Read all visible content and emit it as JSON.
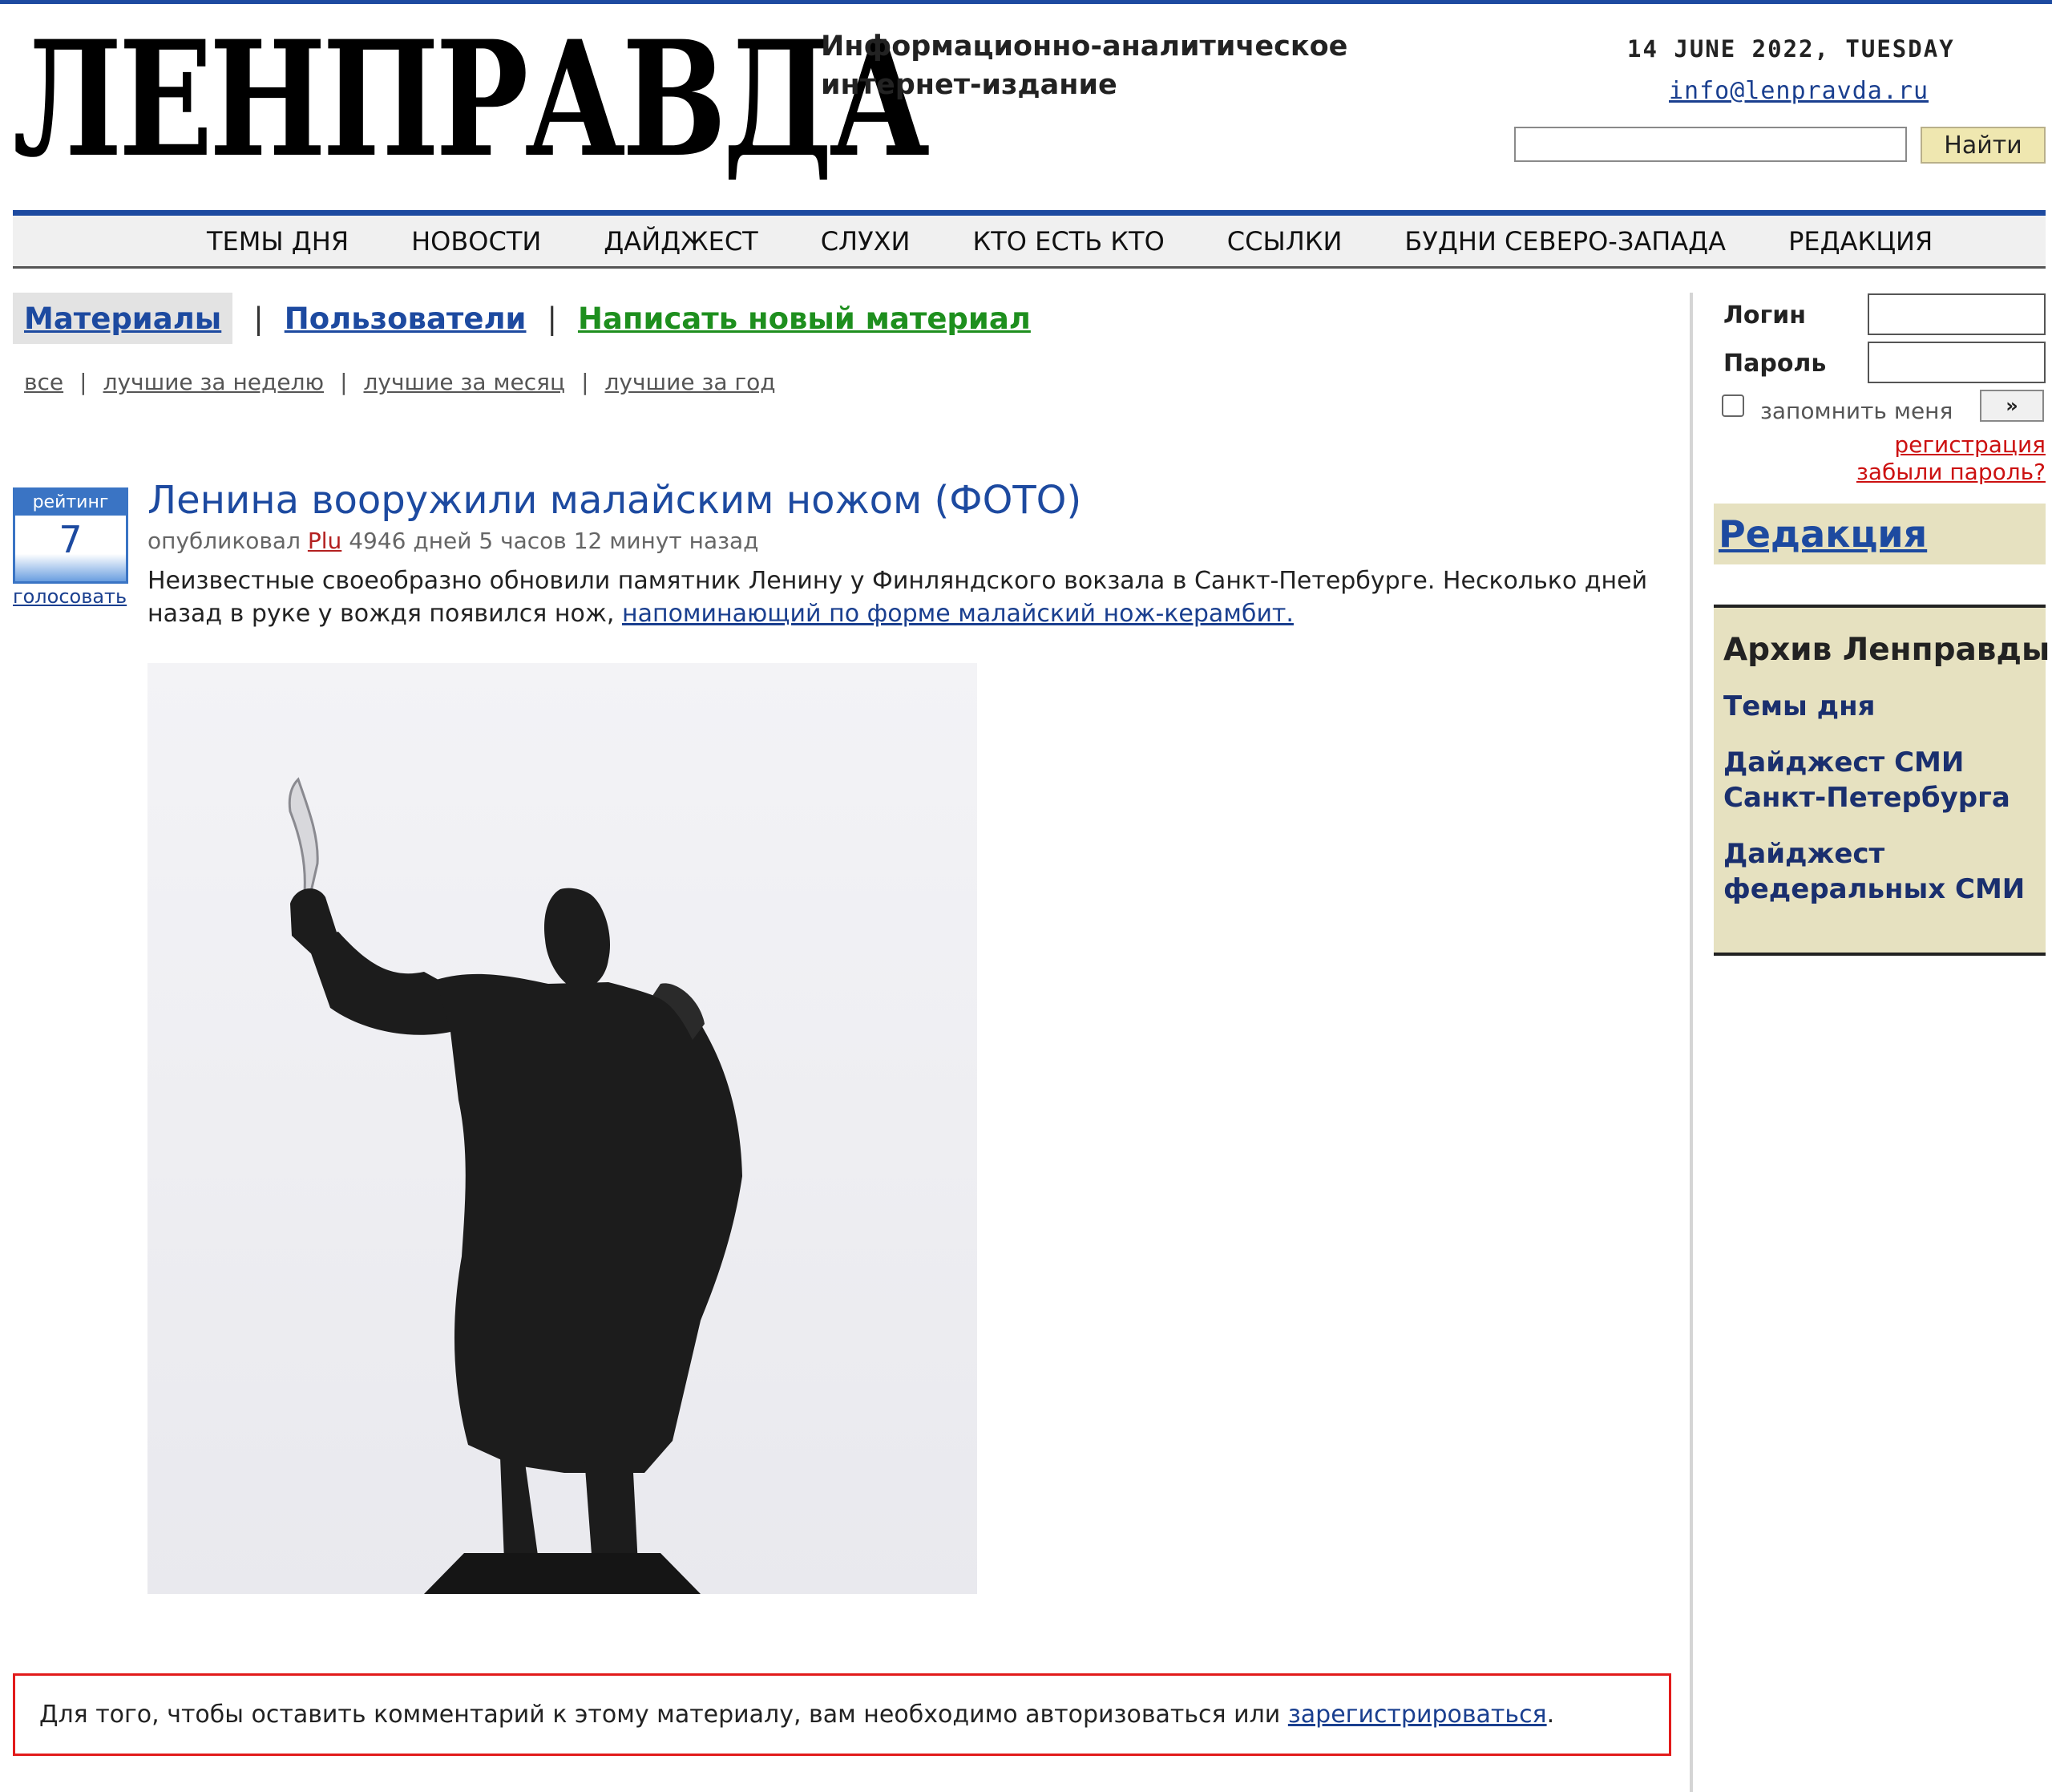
{
  "header": {
    "logo_text": "ЛЕНПРАВДА",
    "tagline": "Информационно-аналитическое интернет-издание",
    "date": "14 JUNE 2022, TUESDAY",
    "email": "info@lenpravda.ru",
    "search_placeholder": "",
    "search_button": "Найти"
  },
  "nav": {
    "items": [
      "ТЕМЫ ДНЯ",
      "НОВОСТИ",
      "ДАЙДЖЕСТ",
      "СЛУХИ",
      "КТО ЕСТЬ КТО",
      "ССЫЛКИ",
      "БУДНИ СЕВЕРО-ЗАПАДА",
      "РЕДАКЦИЯ"
    ]
  },
  "tabs": {
    "materials": "Материалы",
    "users": "Пользователи",
    "write_new": "Написать новый материал",
    "separator": "|"
  },
  "filters": {
    "items": [
      "все",
      "лучшие за неделю",
      "лучшие за месяц",
      "лучшие за год"
    ],
    "separator": "|"
  },
  "rating": {
    "header": "рейтинг",
    "value": "7",
    "vote_link": "голосовать"
  },
  "article": {
    "title": "Ленина вооружили малайским ножом (ФОТО)",
    "published_by": "опубликовал",
    "author": "Plu",
    "time_ago": "4946 дней 5 часов 12 минут назад",
    "lead_text": "Неизвестные своеобразно обновили памятник Ленину у Финляндского вокзала в Санкт-Петербурге. Несколько дней назад в руке у вождя появился нож,",
    "lead_link": "напоминающий по форме малайский нож-керамбит."
  },
  "comment": {
    "text": "Для того, чтобы оставить комментарий к этому материалу, вам необходимо авторизоваться или",
    "register_link": "зарегистрироваться",
    "suffix": "."
  },
  "sidebar": {
    "login_label": "Логин",
    "password_label": "Пароль",
    "remember_label": "запомнить меня",
    "go_button": "»",
    "register": "регистрация",
    "forgot": "забыли пароль?",
    "editorial": "Редакция",
    "archive_title": "Архив Ленправды",
    "archive_links": [
      "Темы дня",
      "Дайджест СМИ Санкт-Петербурга",
      "Дайджест федеральных СМИ"
    ]
  },
  "colors": {
    "brand_blue": "#1d4aa0",
    "link_green": "#1e8f1e",
    "alert_red": "#e21b1b",
    "sidebar_beige": "#e6e1c0"
  }
}
